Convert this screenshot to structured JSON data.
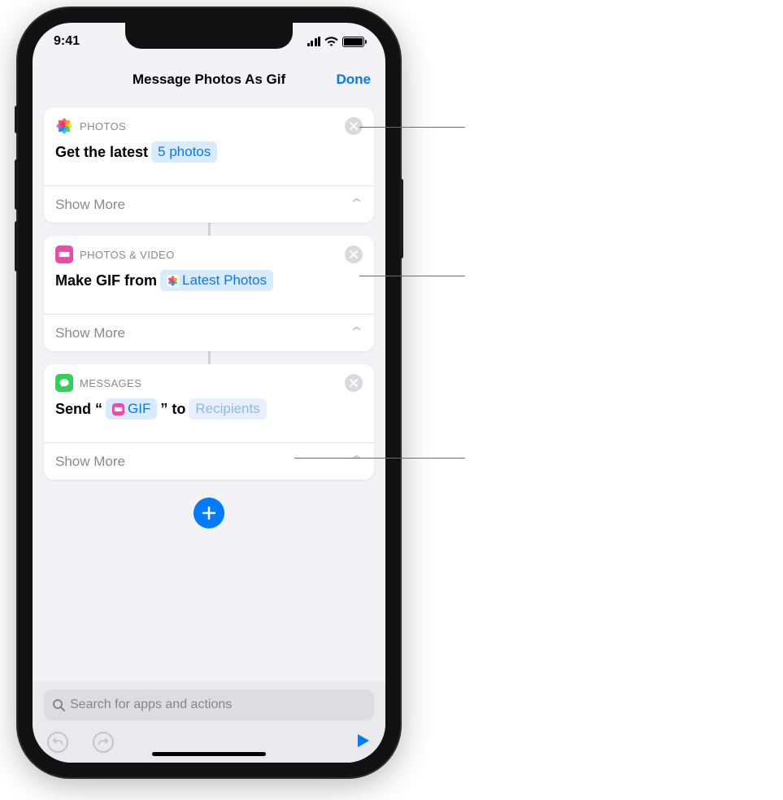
{
  "status": {
    "time": "9:41"
  },
  "nav": {
    "title": "Message Photos As Gif",
    "done": "Done"
  },
  "actions": [
    {
      "app": "PHOTOS",
      "icon": "photos",
      "body_prefix": "Get the latest",
      "token": "5 photos",
      "token_icon": null,
      "show_more": "Show More"
    },
    {
      "app": "PHOTOS & VIDEO",
      "icon": "photos-video",
      "body_prefix": "Make GIF from",
      "token": "Latest Photos",
      "token_icon": "photos",
      "show_more": "Show More"
    },
    {
      "app": "MESSAGES",
      "icon": "messages",
      "send_prefix": "Send “",
      "send_token": "GIF",
      "send_token_icon": "photos-video",
      "send_middle": "” to",
      "recipients_token": "Recipients",
      "show_more": "Show More"
    }
  ],
  "search": {
    "placeholder": "Search for apps and actions"
  }
}
